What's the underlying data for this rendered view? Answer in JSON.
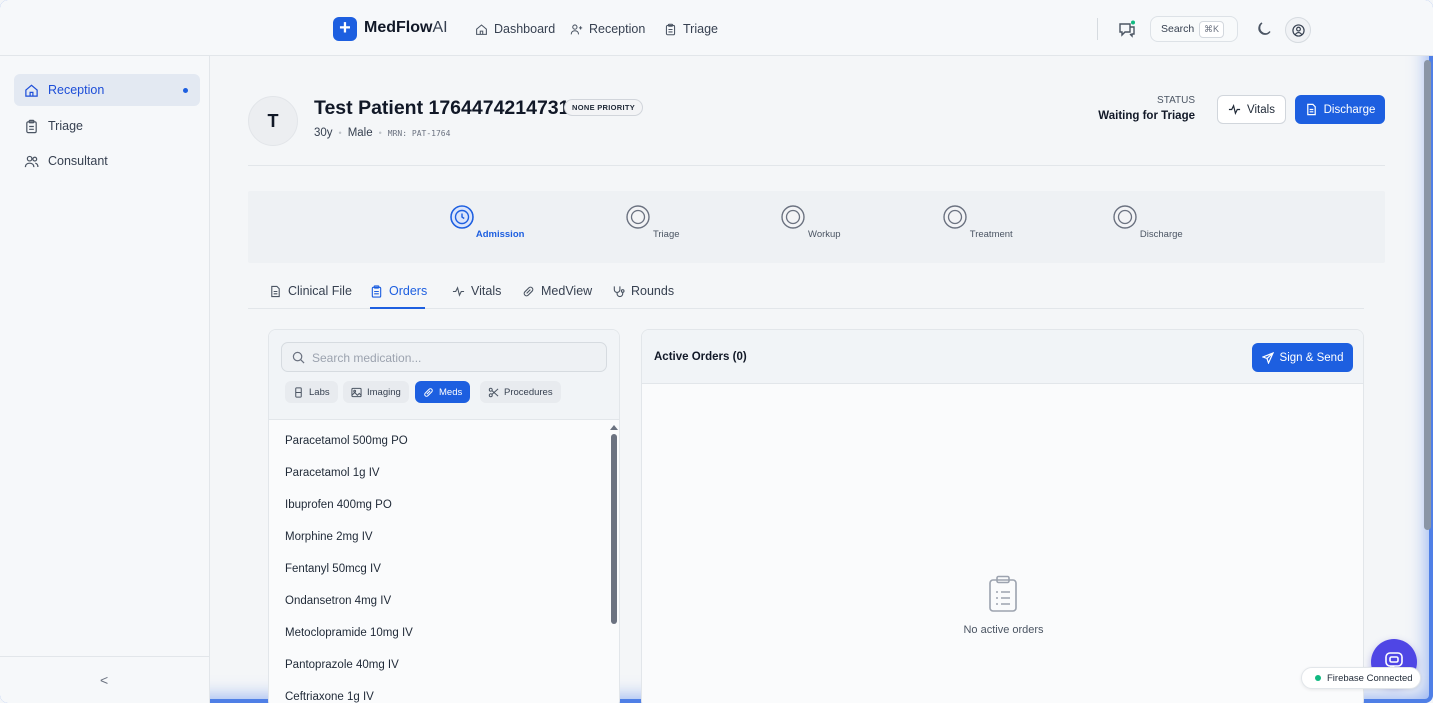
{
  "app": {
    "name_bold": "MedFlow",
    "name_light": "AI"
  },
  "topnav": [
    {
      "label": "Dashboard",
      "icon": "home-icon"
    },
    {
      "label": "Reception",
      "icon": "user-plus-icon"
    },
    {
      "label": "Triage",
      "icon": "clipboard-icon"
    }
  ],
  "search": {
    "label": "Search",
    "shortcut": "⌘K"
  },
  "sidebar": {
    "items": [
      {
        "label": "Reception",
        "icon": "home-icon",
        "active": true
      },
      {
        "label": "Triage",
        "icon": "clipboard-icon",
        "active": false
      },
      {
        "label": "Consultant",
        "icon": "users-icon",
        "active": false
      }
    ],
    "collapse_glyph": "<"
  },
  "patient": {
    "initial": "T",
    "name": "Test Patient 1764474214731",
    "priority": "NONE PRIORITY",
    "age": "30y",
    "sex": "Male",
    "mrn": "MRN: PAT-1764",
    "status_label": "STATUS",
    "status_value": "Waiting for Triage"
  },
  "actions": {
    "vitals": "Vitals",
    "discharge": "Discharge"
  },
  "stepper": [
    {
      "label": "Admission",
      "active": true
    },
    {
      "label": "Triage",
      "active": false
    },
    {
      "label": "Workup",
      "active": false
    },
    {
      "label": "Treatment",
      "active": false
    },
    {
      "label": "Discharge",
      "active": false
    }
  ],
  "tabs": [
    {
      "label": "Clinical File",
      "active": false
    },
    {
      "label": "Orders",
      "active": true
    },
    {
      "label": "Vitals",
      "active": false
    },
    {
      "label": "MedView",
      "active": false
    },
    {
      "label": "Rounds",
      "active": false
    }
  ],
  "orders": {
    "search_placeholder": "Search medication...",
    "categories": [
      {
        "label": "Labs",
        "active": false
      },
      {
        "label": "Imaging",
        "active": false
      },
      {
        "label": "Meds",
        "active": true
      },
      {
        "label": "Procedures",
        "active": false
      }
    ],
    "medications": [
      "Paracetamol 500mg PO",
      "Paracetamol 1g IV",
      "Ibuprofen 400mg PO",
      "Morphine 2mg IV",
      "Fentanyl 50mcg IV",
      "Ondansetron 4mg IV",
      "Metoclopramide 10mg IV",
      "Pantoprazole 40mg IV",
      "Ceftriaxone 1g IV"
    ],
    "active_title": "Active Orders (0)",
    "sign_send": "Sign & Send",
    "empty_text": "No active orders"
  },
  "footer": {
    "firebase": "Firebase Connected"
  },
  "colors": {
    "accent": "#1d5fe0",
    "fab": "#4f46e5",
    "connected": "#10b981"
  }
}
